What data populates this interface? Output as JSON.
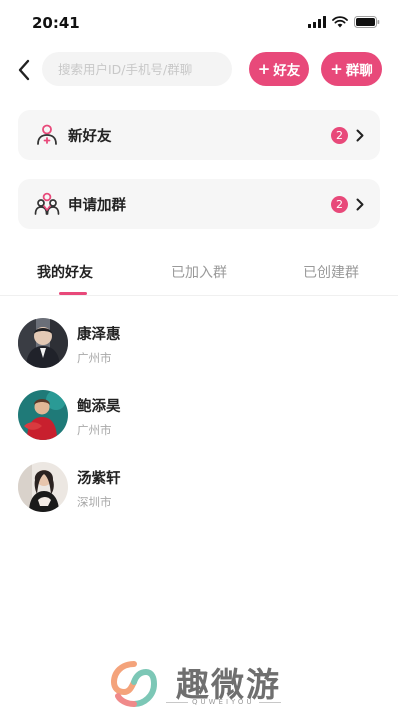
{
  "status_bar": {
    "time": "20:41"
  },
  "header": {
    "search_placeholder": "搜索用户ID/手机号/群聊",
    "add_friend_label": "好友",
    "group_chat_label": "群聊",
    "plus": "+"
  },
  "entries": [
    {
      "label": "新好友",
      "badge": "2",
      "icon": "person-add-icon"
    },
    {
      "label": "申请加群",
      "badge": "2",
      "icon": "group-icon"
    }
  ],
  "tabs": [
    {
      "label": "我的好友",
      "active": true
    },
    {
      "label": "已加入群",
      "active": false
    },
    {
      "label": "已创建群",
      "active": false
    }
  ],
  "friends": [
    {
      "name": "康泽惠",
      "city": "广州市"
    },
    {
      "name": "鲍添昊",
      "city": "广州市"
    },
    {
      "name": "汤紫轩",
      "city": "深圳市"
    }
  ],
  "watermark": {
    "text": "趣微游",
    "sub": "QUWEIYOU"
  },
  "colors": {
    "accent": "#e8497a",
    "card_bg": "#f6f6f6"
  }
}
